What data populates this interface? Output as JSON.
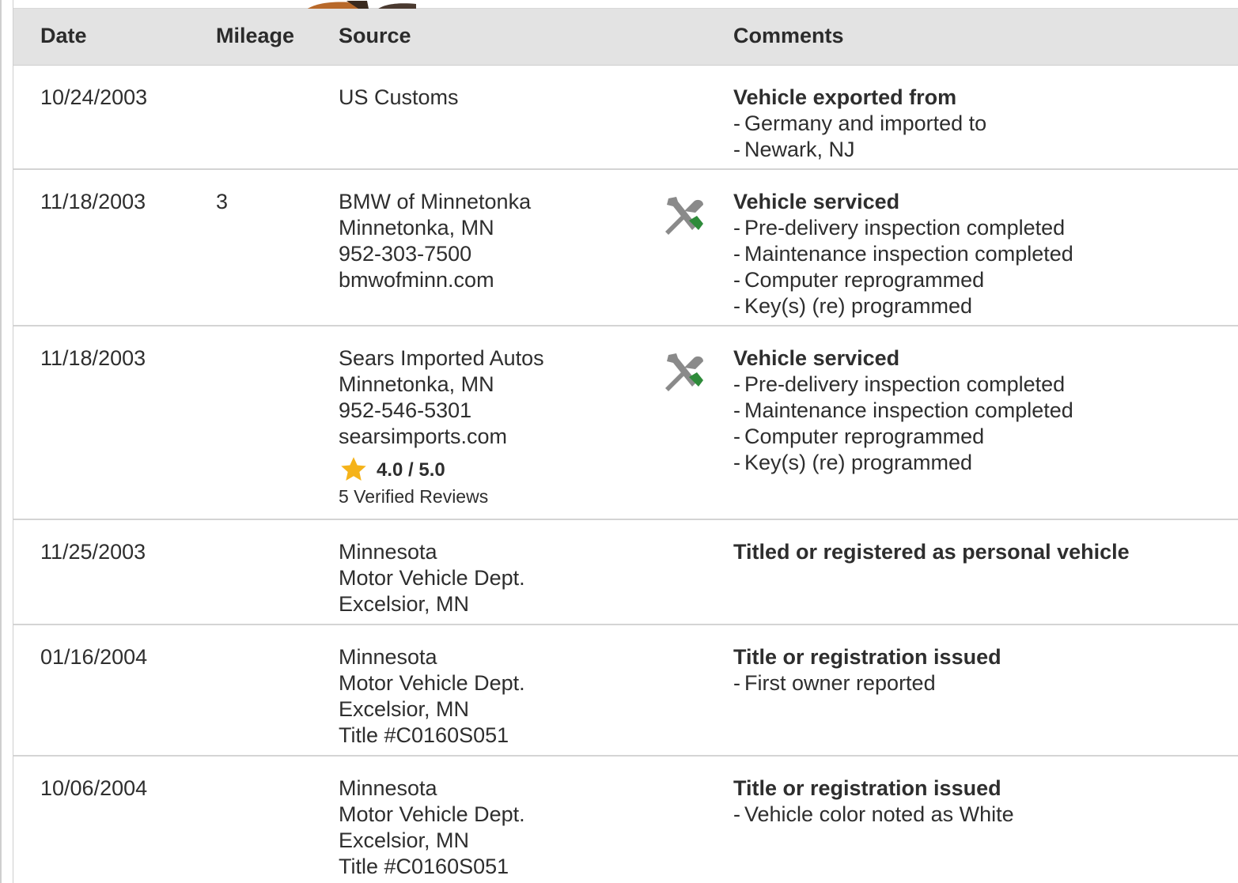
{
  "header": {
    "date": "Date",
    "mileage": "Mileage",
    "source": "Source",
    "comments": "Comments"
  },
  "rows": [
    {
      "date": "10/24/2003",
      "mileage": "",
      "source": [
        "US Customs"
      ],
      "icon": "",
      "comment_title": "Vehicle exported from",
      "comment_items": [
        "Germany and imported to",
        "Newark, NJ"
      ]
    },
    {
      "date": "11/18/2003",
      "mileage": "3",
      "source": [
        "BMW of Minnetonka",
        "Minnetonka, MN",
        "952-303-7500",
        "bmwofminn.com"
      ],
      "icon": "service-wrench-screwdriver-icon",
      "comment_title": "Vehicle serviced",
      "comment_items": [
        "Pre-delivery inspection completed",
        "Maintenance inspection completed",
        "Computer reprogrammed",
        "Key(s) (re) programmed"
      ]
    },
    {
      "date": "11/18/2003",
      "mileage": "",
      "source": [
        "Sears Imported Autos",
        "Minnetonka, MN",
        "952-546-5301",
        "searsimports.com"
      ],
      "rating": "4.0 / 5.0",
      "reviews": "5 Verified Reviews",
      "icon": "service-wrench-screwdriver-icon",
      "comment_title": "Vehicle serviced",
      "comment_items": [
        "Pre-delivery inspection completed",
        "Maintenance inspection completed",
        "Computer reprogrammed",
        "Key(s) (re) programmed"
      ]
    },
    {
      "date": "11/25/2003",
      "mileage": "",
      "source": [
        "Minnesota",
        "Motor Vehicle Dept.",
        "Excelsior, MN"
      ],
      "icon": "",
      "comment_title": "Titled or registered as personal vehicle",
      "comment_items": []
    },
    {
      "date": "01/16/2004",
      "mileage": "",
      "source": [
        "Minnesota",
        "Motor Vehicle Dept.",
        "Excelsior, MN",
        "Title #C0160S051"
      ],
      "icon": "",
      "comment_title": "Title or registration issued",
      "comment_items": [
        "First owner reported"
      ]
    },
    {
      "date": "10/06/2004",
      "mileage": "",
      "source": [
        "Minnesota",
        "Motor Vehicle Dept.",
        "Excelsior, MN",
        "Title #C0160S051"
      ],
      "icon": "",
      "comment_title": "Title or registration issued",
      "comment_items": [
        "Vehicle color noted as White"
      ]
    }
  ],
  "colors": {
    "header_bg": "#e3e3e3",
    "row_border": "#d4d4d4",
    "star": "#f5b31a",
    "screwdriver": "#2e8b3a",
    "wrench": "#8a8a8a"
  }
}
